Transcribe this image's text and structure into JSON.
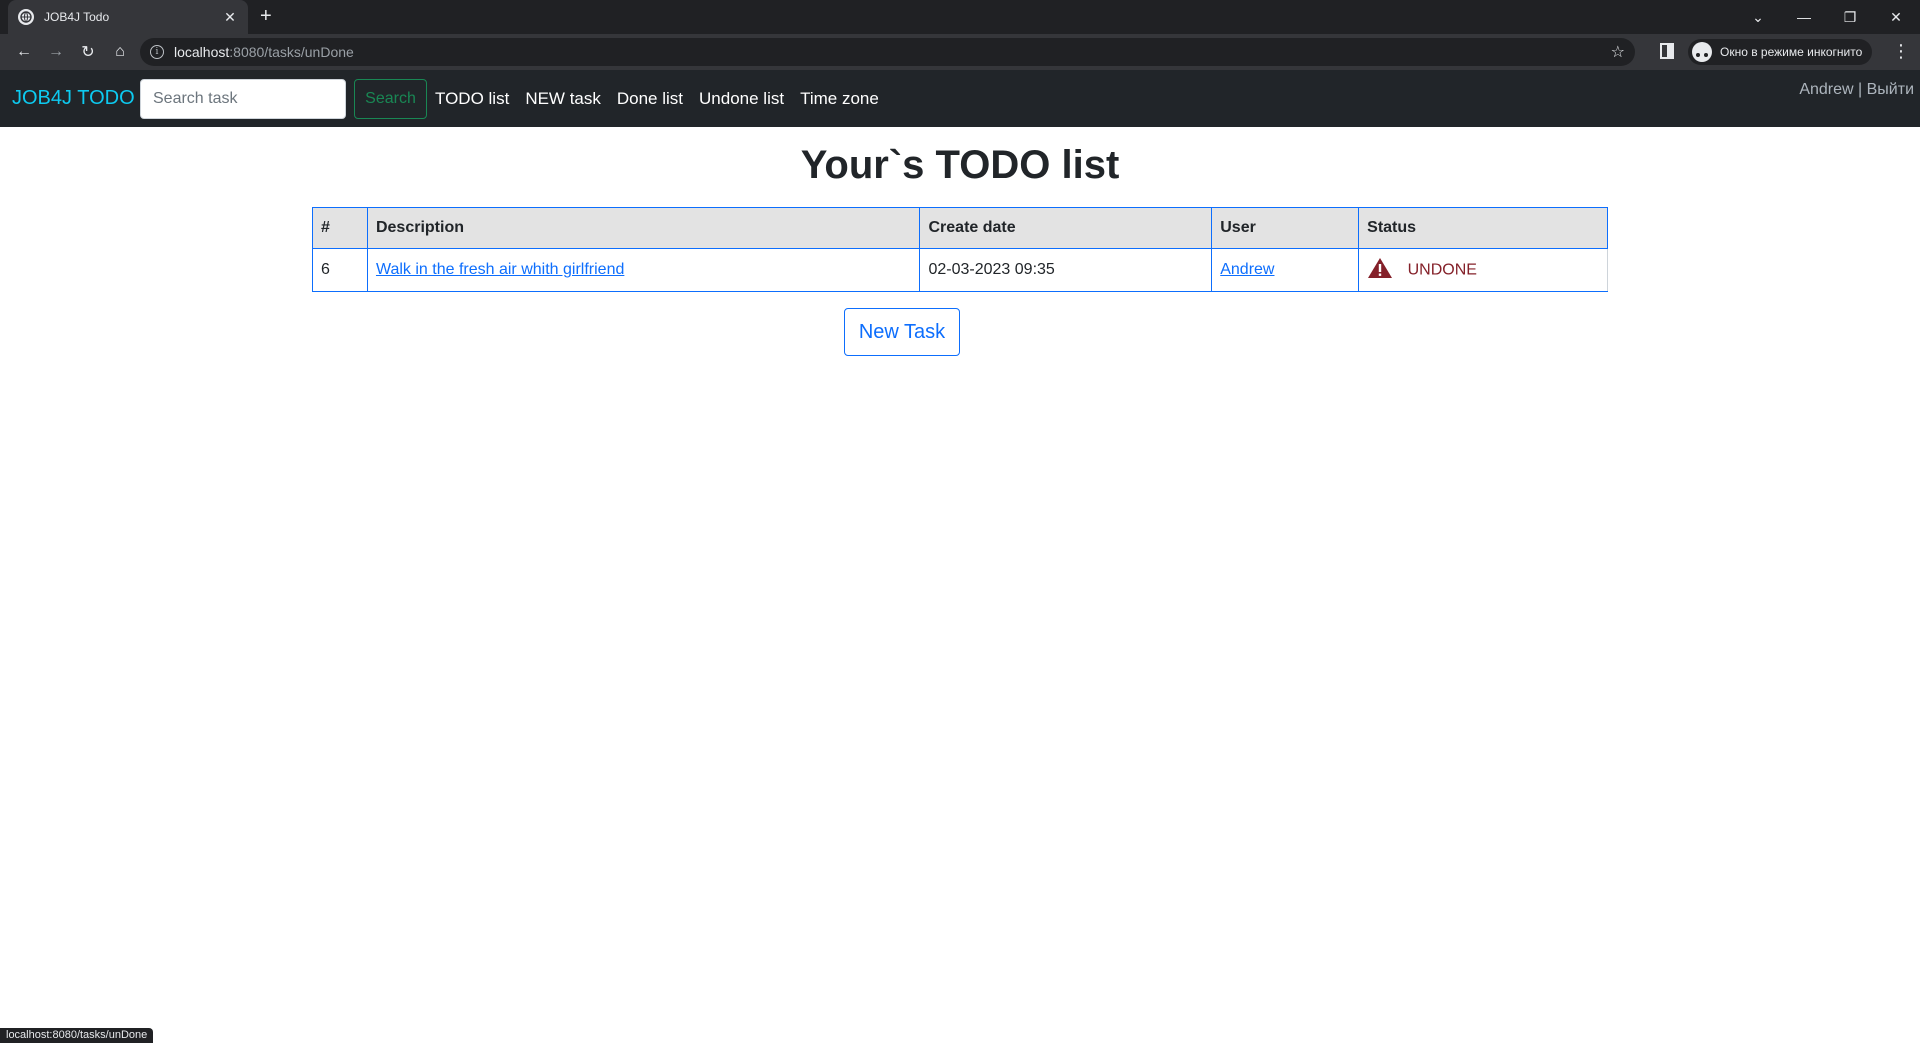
{
  "browser": {
    "tab_title": "JOB4J Todo",
    "tab_close": "✕",
    "new_tab": "+",
    "url_host": "localhost",
    "url_path": ":8080/tasks/unDone",
    "incognito_label": "Окно в режиме инкогнито",
    "status_url": "localhost:8080/tasks/unDone",
    "icons": [
      "back-icon",
      "forward-icon",
      "reload-icon",
      "home-icon",
      "info-icon",
      "star-icon",
      "side-panel-icon",
      "incognito-icon",
      "menu-icon"
    ]
  },
  "navbar": {
    "brand": "JOB4J TODO",
    "search_placeholder": "Search task",
    "search_button": "Search",
    "links": [
      "TODO list",
      "NEW task",
      "Done list",
      "Undone list",
      "Time zone"
    ],
    "user_name": "Andrew",
    "separator": "|",
    "logout": "Выйти"
  },
  "main": {
    "title": "Your`s TODO list",
    "table": {
      "headers": [
        "#",
        "Description",
        "Create date",
        "User",
        "Status"
      ],
      "rows": [
        {
          "id": "6",
          "description": "Walk in the fresh air whith girlfriend",
          "created": "02-03-2023 09:35",
          "user": "Andrew",
          "status": "UNDONE"
        }
      ]
    },
    "new_task_button": "New Task"
  },
  "colors": {
    "navbar_bg": "#212529",
    "brand": "#0dcaf0",
    "success": "#198754",
    "primary": "#0d6efd",
    "danger_text": "#842029"
  }
}
